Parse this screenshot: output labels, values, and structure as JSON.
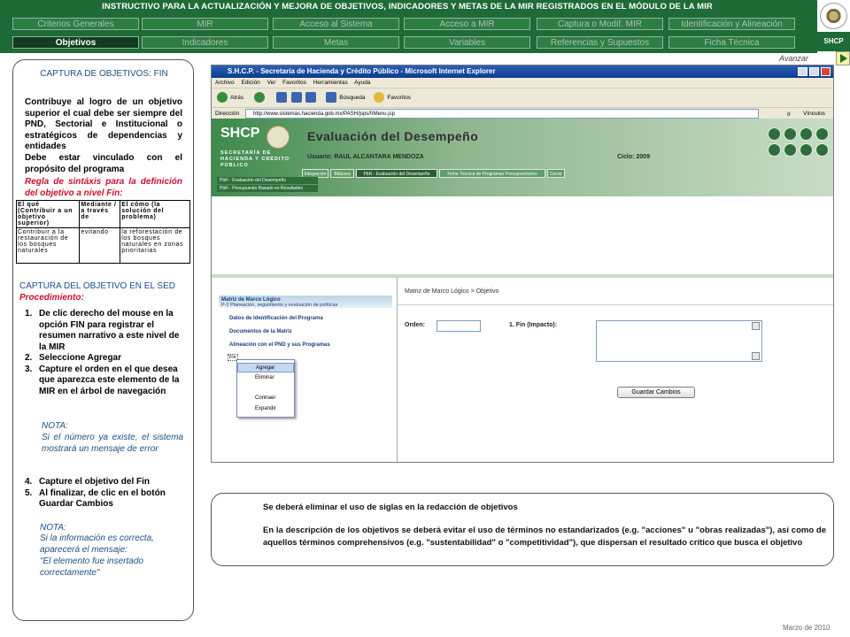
{
  "header": {
    "title": "INSTRUCTIVO PARA LA ACTUALIZACIÓN Y MEJORA DE OBJETIVOS, INDICADORES Y METAS DE LA MIR REGISTRADOS EN EL MÓDULO DE LA MIR",
    "nav_row1": [
      "Criterios Generales",
      "MIR",
      "Acceso al Sistema",
      "Acceso a MIR",
      "Captura o Modif. MIR",
      "Identificación y Alineación"
    ],
    "nav_row2": [
      "Objetivos",
      "Indicadores",
      "Metas",
      "Variables",
      "Referencias y Supuestos",
      "Ficha Técnica"
    ],
    "logo_text": "SHCP",
    "avanzar": "Avanzar"
  },
  "left": {
    "capture_title": "CAPTURA DE OBJETIVOS: FIN",
    "fin_text": "Contribuye al logro de un objetivo superior el cual debe ser siempre del PND, Sectorial e Institucional o estratégicos de dependencias y entidades",
    "vinculado_text": "Debe estar vinculado con el propósito del programa",
    "rule_text": "Regla de sintáxis para la definición del objetivo a nivel Fin:",
    "table": {
      "headers": [
        "El qué (Contribuir a un objetivo superior)",
        "Mediante / a través de",
        "El cómo (la solución del problema)"
      ],
      "row": [
        "Contribuir a la restauración de los bosques naturales",
        "evitando",
        "la reforestación de los bosques naturales en zonas prioritarias"
      ]
    },
    "sed_title": "CAPTURA DEL OBJETIVO EN EL SED",
    "procedimiento": "Procedimiento:",
    "steps_a": [
      {
        "n": "1.",
        "t": "De clic derecho del mouse en la opción FIN para registrar el resumen narrativo a este nivel de la MIR"
      },
      {
        "n": "2.",
        "t": "Seleccione Agregar"
      },
      {
        "n": "3.",
        "t": "Capture el orden en el que desea que aparezca este elemento de la MIR en el árbol de navegación"
      }
    ],
    "nota1_title": "NOTA:",
    "nota1_text": "Si el número ya existe, el sistema mostrará un mensaje de error",
    "steps_b": [
      {
        "n": "4.",
        "t": "Capture el objetivo del Fin"
      },
      {
        "n": "5.",
        "t": "Al finalizar, de clic en el botón Guardar Cambios"
      }
    ],
    "nota2_title": "NOTA:",
    "nota2_text": "Si la información es correcta, aparecerá el mensaje:",
    "nota2_msg": "\"El elemento fue insertado correctamente\""
  },
  "browser": {
    "title": "S.H.C.P. - Secretaría de Hacienda y Crédito Público - Microsoft Internet Explorer",
    "menu": "Archivo Edición Ver Favoritos Herramientas Ayuda",
    "tools": {
      "back": "Atrás",
      "search": "Búsqueda",
      "favorites": "Favoritos"
    },
    "address_label": "Dirección",
    "address": "http://www.sistemas.hacienda.gob.mx/PASH/jsps/frMenu.jsp",
    "go": "Ir",
    "vinculos": "Vínculos"
  },
  "app": {
    "logo": "SHCP",
    "logo_sub": "SECRETARÍA DE HACIENDA Y CRÉDITO PÚBLICO",
    "heading": "Evaluación del Desempeño",
    "user": "Usuario: RAUL ALCANTARA MENDOZA",
    "ciclo": "Ciclo: 2009",
    "tabs": [
      "Integración",
      "Bitácora",
      "PbR - Evaluación del Desempeño",
      "Ficha Técnica de Programas Presupuestarios",
      "Cerrar"
    ],
    "pbr_eval": "PbR - Evaluación del Desempeño",
    "pbr_pres": "PbR - Presupuesto Basado en Resultados",
    "tree_title": "Matriz de Marco Lógico",
    "tree_sub": "P-2 Planeación, seguimiento y evaluación de políticas",
    "tree_items": [
      "Datos de Identificación del Programa",
      "Documentos de la Matriz",
      "Alineación con el PND y sus Programas"
    ],
    "tree_fin": "Fin",
    "context_menu": [
      "Agregar",
      "Eliminar",
      "Contraer",
      "Expandir"
    ],
    "breadcrumb": "Matriz de Marco Lógico > Objetivo",
    "orden_label": "Orden:",
    "fin_label": "1. Fin (Impacto):",
    "save_button": "Guardar Cambios"
  },
  "note": {
    "line1": "Se deberá eliminar el uso de siglas en la redacción de objetivos",
    "line2": "En la descripción de los objetivos se deberá evitar el uso de términos no estandarizados (e.g. \"acciones\" u \"obras realizadas\"), así como de aquellos términos comprehensivos (e.g. \"sustentabilidad\" o \"competitividad\"), que dispersan el resultado crítico que busca el objetivo"
  },
  "footer": "Marzo de 2010"
}
